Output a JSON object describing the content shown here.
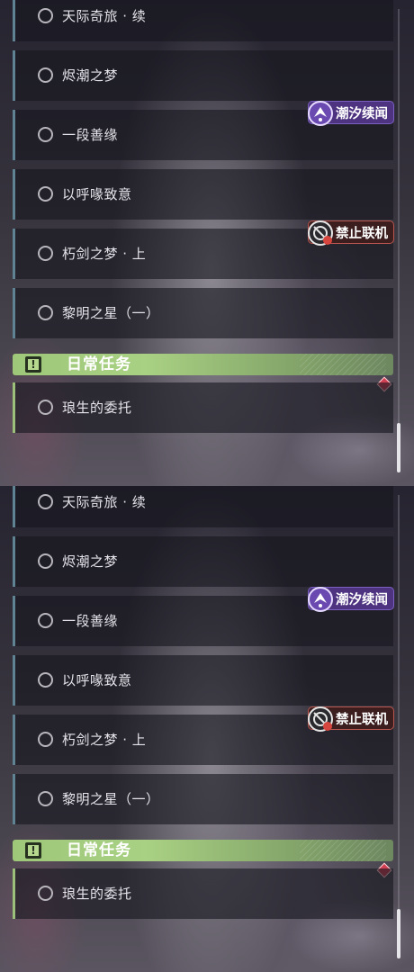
{
  "quests": [
    {
      "title": "天际奇旅 · 续"
    },
    {
      "title": "烬潮之梦"
    },
    {
      "title": "一段善缘"
    },
    {
      "title": "以呼喙致意"
    },
    {
      "title": "朽剑之梦 · 上"
    },
    {
      "title": "黎明之星（一）"
    }
  ],
  "tags": {
    "event": {
      "label": "潮汐续闻",
      "icon": "tide-event-icon",
      "color": "#4d3380"
    },
    "no_coop": {
      "label": "禁止联机",
      "icon": "no-coop-icon",
      "color": "#3c1e1f"
    }
  },
  "daily": {
    "header": "日常任务",
    "icon": "alert-icon",
    "accent": "#9ec779",
    "quest": {
      "title": "琅生的委托"
    }
  },
  "colors": {
    "accent_teal": "#5f8393",
    "accent_green": "#9bc07a",
    "marker_red": "#d13f52"
  }
}
